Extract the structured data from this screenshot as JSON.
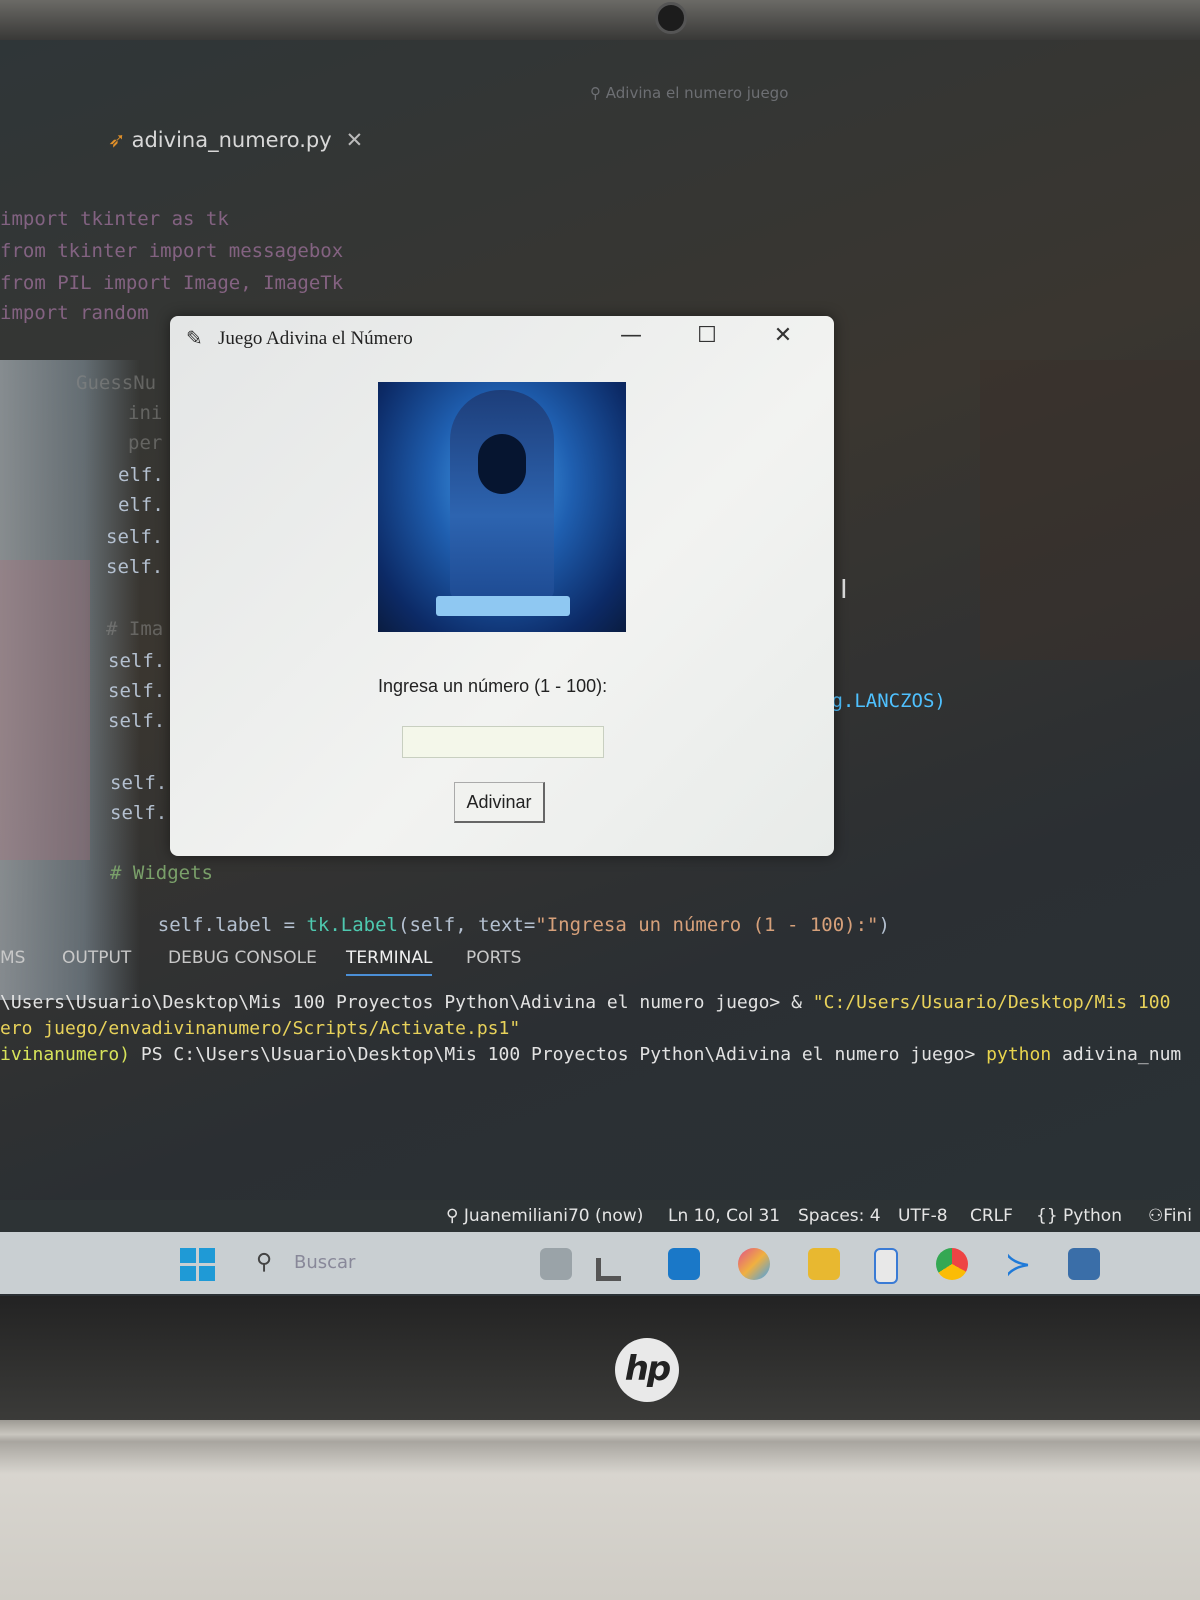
{
  "vscode": {
    "window_title": "Adivina el numero juego",
    "tab_filename": "adivina_numero.py",
    "tab_close": "✕",
    "code_lines": [
      {
        "text": "import tkinter as tk"
      },
      {
        "text": "from tkinter import messagebox"
      },
      {
        "text": "from PIL import Image, ImageTk"
      },
      {
        "text": "import random"
      }
    ],
    "partial_lines": [
      "GuessNu",
      "ini",
      "per",
      "elf.",
      "elf.",
      "self.",
      "self.",
      "# Ima",
      "self.",
      "self.",
      "self.",
      "self.",
      "self."
    ],
    "code_tail": "ng.LANCZOS)",
    "comment_widgets": "# Widgets",
    "label_line": {
      "prefix": "self.label",
      "eq": " = ",
      "cls": "tk.Label",
      "args": "(self, text=",
      "str": "\"Ingresa un número (1 - 100):\"",
      "close": ")"
    }
  },
  "panel": {
    "tabs": [
      "MS",
      "OUTPUT",
      "DEBUG CONSOLE",
      "TERMINAL",
      "PORTS"
    ],
    "active_tab": "TERMINAL",
    "terminal_lines": {
      "line1_a": "\\Users\\Usuario\\Desktop\\Mis 100 Proyectos Python\\Adivina el numero juego> & ",
      "line1_b": "\"C:/Users/Usuario/Desktop/Mis 100",
      "line2": "ero juego/envadivinanumero/Scripts/Activate.ps1\"",
      "line3_a": "ivinanumero)",
      "line3_b": " PS C:\\Users\\Usuario\\Desktop\\Mis 100 Proyectos Python\\Adivina el numero juego> ",
      "line3_c": "python",
      "line3_d": " adivina_num"
    }
  },
  "statusbar": {
    "git_user": "Juanemiliani70 (now)",
    "position": "Ln 10, Col 31",
    "spaces": "Spaces: 4",
    "encoding": "UTF-8",
    "eol": "CRLF",
    "language": "{} Python",
    "finish": "Fini"
  },
  "taskbar": {
    "search_placeholder": "Buscar"
  },
  "dialog": {
    "title": "Juego Adivina el Número",
    "minimize": "—",
    "maximize": "☐",
    "close": "✕",
    "prompt": "Ingresa un número (1 - 100):",
    "input_value": "",
    "button": "Adivinar"
  },
  "brand": {
    "logo": "hp"
  },
  "colors": {
    "accent": "#4b8fd6",
    "dialog_bg": "#eef0ee",
    "hero_blue": "#1f5fb0"
  }
}
